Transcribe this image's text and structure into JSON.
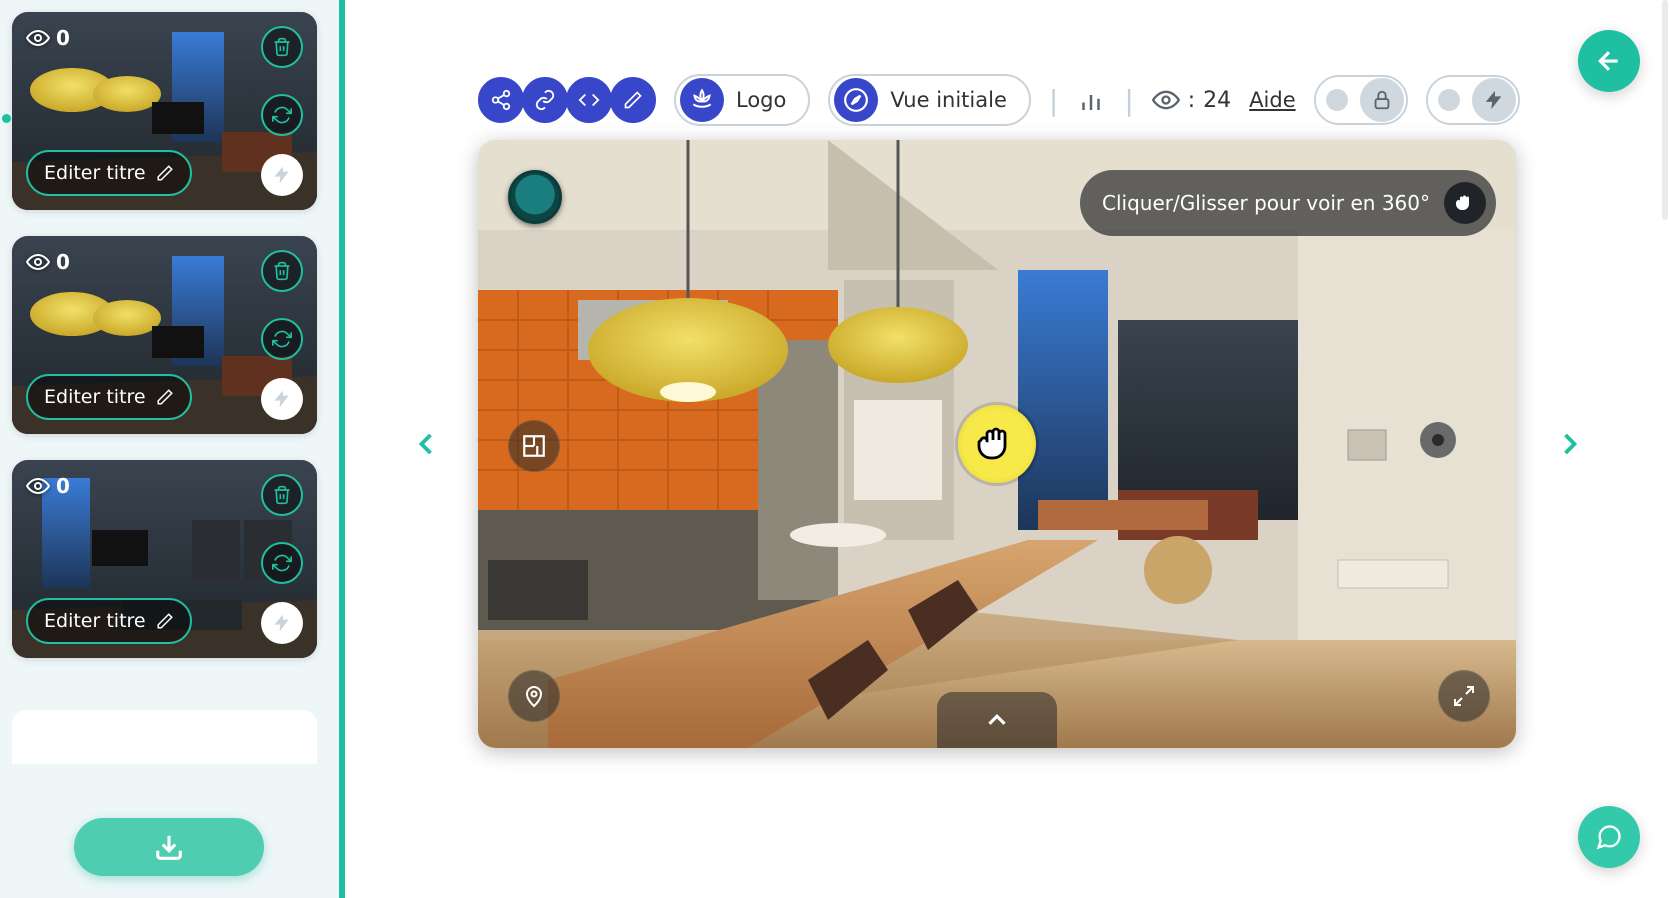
{
  "sidebar": {
    "thumbnails": [
      {
        "views": 0,
        "edit_label": "Editer titre"
      },
      {
        "views": 0,
        "edit_label": "Editer titre"
      },
      {
        "views": 0,
        "edit_label": "Editer titre"
      }
    ]
  },
  "toolbar": {
    "logo_label": "Logo",
    "initial_view_label": "Vue initiale",
    "help_label": "Aide",
    "view_count_prefix": ":",
    "view_count": 24
  },
  "viewer": {
    "hint": "Cliquer/Glisser pour voir en 360°"
  },
  "colors": {
    "teal": "#1fbfa1",
    "blue": "#3847c9"
  }
}
